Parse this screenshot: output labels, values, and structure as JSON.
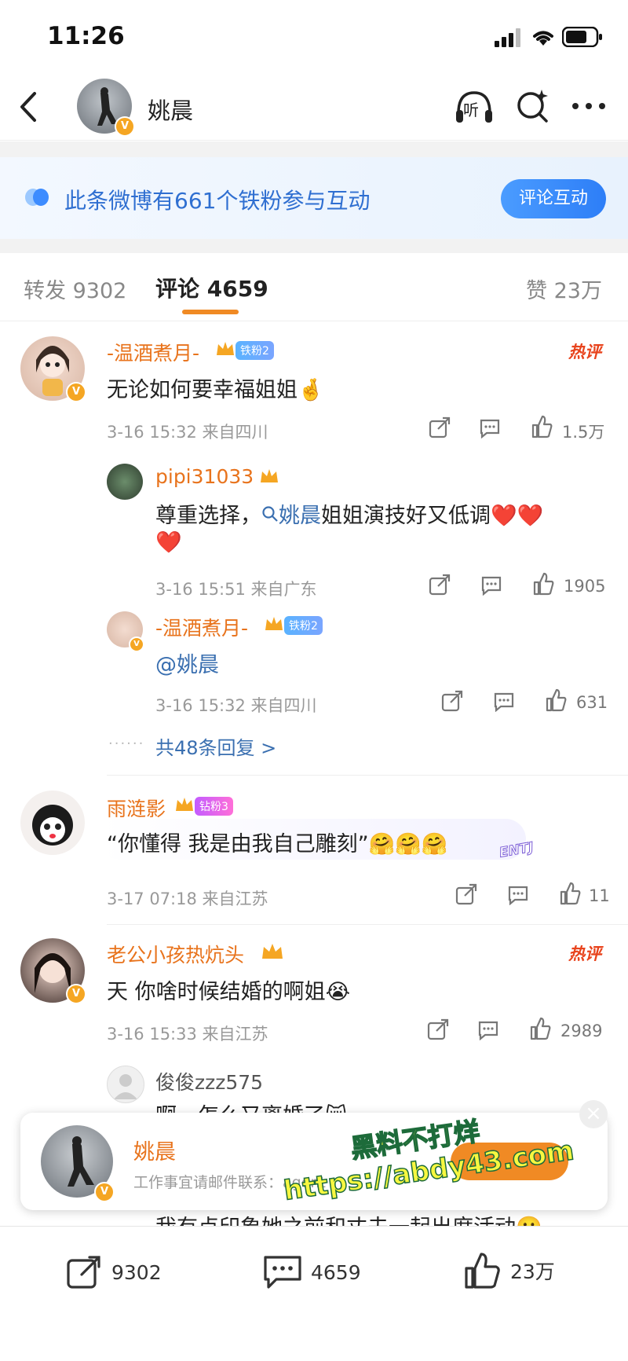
{
  "status_bar": {
    "time": "11:26"
  },
  "header": {
    "username": "姚晨",
    "listen_label": "听"
  },
  "banner": {
    "text": "此条微博有661个铁粉参与互动",
    "button": "评论互动"
  },
  "tabs": {
    "repost": "转发 9302",
    "comment": "评论 4659",
    "like": "赞 23万"
  },
  "comments": [
    {
      "name": "-温酒煮月-",
      "badge": "铁粉2",
      "hot": "热评",
      "text": "无论如何要幸福姐姐🤞",
      "meta": "3-16 15:32 来自四川",
      "likes": "1.5万",
      "replies": [
        {
          "name": "pipi31033",
          "text_a": "尊重选择，",
          "mention": "姚晨",
          "text_b": "姐姐演技好又低调❤️❤️",
          "text_c": "❤️",
          "meta": "3-16 15:51 来自广东",
          "likes": "1905"
        },
        {
          "name": "-温酒煮月-",
          "badge": "铁粉2",
          "text": "@姚晨",
          "meta": "3-16 15:32 来自四川",
          "likes": "631"
        }
      ],
      "more": "共48条回复 >"
    },
    {
      "name": "雨涟影",
      "badge": "钻粉3",
      "text": "“你懂得 我是由我自己雕刻”🤗🤗🤗",
      "tag": "ENTJ",
      "meta": "3-17 07:18 来自江苏",
      "likes": "11"
    },
    {
      "name": "老公小孩热炕头",
      "hot": "热评",
      "text": "天 你啥时候结婚的啊姐😭",
      "meta": "3-16 15:33 来自江苏",
      "likes": "2989",
      "reply": {
        "name": "俊俊zzz575",
        "text": "啊，怎么又离婚了😿"
      },
      "partial": "我有点印象她之前和丈夫一起出席活动🙂"
    }
  ],
  "popup": {
    "name": "姚晨",
    "sub": "工作事宜请邮件联系：agent",
    "close": "×"
  },
  "watermark": {
    "line1": "黑料不打烊",
    "line2": "https://abdy43.com"
  },
  "bottom_bar": {
    "repost": "9302",
    "comment": "4659",
    "like": "23万"
  }
}
